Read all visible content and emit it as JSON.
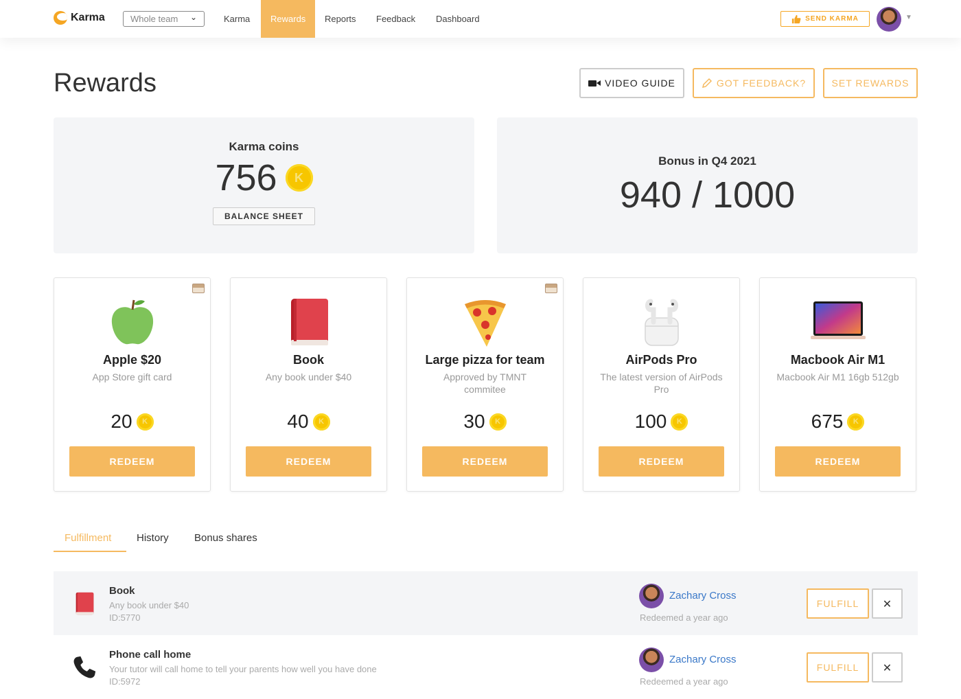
{
  "app": {
    "name": "Karma"
  },
  "nav": {
    "team_select": "Whole team",
    "items": [
      "Karma",
      "Rewards",
      "Reports",
      "Feedback",
      "Dashboard"
    ],
    "active": "Rewards",
    "send_karma": "SEND KARMA"
  },
  "page": {
    "title": "Rewards",
    "video_guide": "VIDEO GUIDE",
    "got_feedback": "GOT FEEDBACK?",
    "set_rewards": "SET REWARDS"
  },
  "stats": {
    "karma_label": "Karma coins",
    "karma_value": "756",
    "balance_sheet": "BALANCE SHEET",
    "bonus_label": "Bonus in Q4 2021",
    "bonus_value": "940 / 1000"
  },
  "coin_glyph": "K",
  "rewards": [
    {
      "title": "Apple $20",
      "desc": "App Store gift card",
      "price": "20",
      "redeem": "REDEEM",
      "icon": "apple-icon"
    },
    {
      "title": "Book",
      "desc": "Any book under $40",
      "price": "40",
      "redeem": "REDEEM",
      "icon": "book-icon"
    },
    {
      "title": "Large pizza for team",
      "desc": "Approved by TMNT commitee",
      "price": "30",
      "redeem": "REDEEM",
      "icon": "pizza-icon"
    },
    {
      "title": "AirPods Pro",
      "desc": "The latest version of AirPods Pro",
      "price": "100",
      "redeem": "REDEEM",
      "icon": "airpods-icon"
    },
    {
      "title": "Macbook Air M1",
      "desc": "Macbook Air M1 16gb 512gb",
      "price": "675",
      "redeem": "REDEEM",
      "icon": "laptop-icon"
    }
  ],
  "tabs": [
    "Fulfillment",
    "History",
    "Bonus shares"
  ],
  "active_tab": "Fulfillment",
  "fulfillment": [
    {
      "title": "Book",
      "desc": "Any book under $40",
      "id": "ID:5770",
      "user": "Zachary Cross",
      "time": "Redeemed a year ago",
      "fulfill": "FULFILL",
      "close": "✕"
    },
    {
      "title": "Phone call home",
      "desc": "Your tutor will call home to tell your parents how well you have done",
      "id": "ID:5972",
      "user": "Zachary Cross",
      "time": "Redeemed a year ago",
      "fulfill": "FULFILL",
      "close": "✕"
    }
  ],
  "colors": {
    "accent": "#f5b95f",
    "link": "#3a78c8",
    "panel": "#f4f5f7",
    "coin": "#f7c600"
  }
}
